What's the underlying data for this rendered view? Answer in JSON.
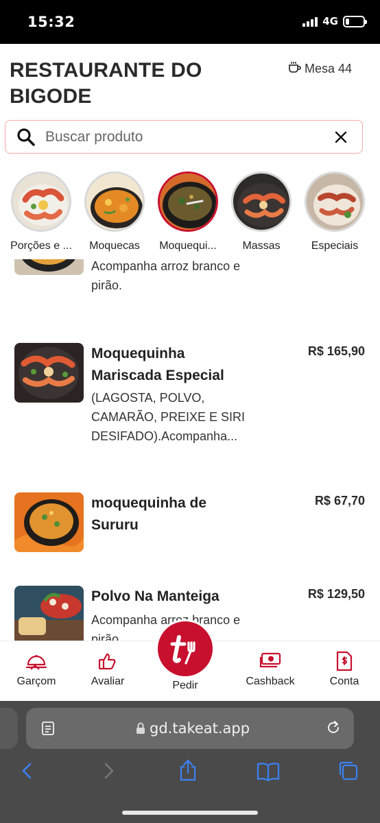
{
  "status_bar": {
    "time": "15:32",
    "network": "4G",
    "battery_level": 0.22
  },
  "header": {
    "restaurant_name": "RESTAURANTE DO BIGODE",
    "table_label": "Mesa 44"
  },
  "search": {
    "placeholder": "Buscar produto",
    "value": ""
  },
  "categories": [
    {
      "label": "Porções e ...",
      "active": false
    },
    {
      "label": "Moquecas",
      "active": false
    },
    {
      "label": "Moquequi...",
      "active": true
    },
    {
      "label": "Massas",
      "active": false
    },
    {
      "label": "Especiais",
      "active": false
    }
  ],
  "products": [
    {
      "name": "",
      "description": "Acompanha arroz branco e pirão.",
      "price": ""
    },
    {
      "name": "Moquequinha Mariscada Especial",
      "description": "(LAGOSTA, POLVO, CAMARÃO, PREIXE E SIRI DESIFADO).Acompanha...",
      "price": "R$ 165,90"
    },
    {
      "name": "moquequinha de Sururu",
      "description": "",
      "price": "R$ 67,70"
    },
    {
      "name": "Polvo Na Manteiga",
      "description": "Acompanha arroz branco e pirão.",
      "price": "R$ 129,50"
    }
  ],
  "bottom_nav": {
    "garcom": "Garçom",
    "avaliar": "Avaliar",
    "pedir": "Pedir",
    "cashback": "Cashback",
    "conta": "Conta"
  },
  "browser": {
    "url": "gd.takeat.app"
  },
  "colors": {
    "accent": "#c8102e",
    "search_border": "#f4a9a9",
    "browser_bg": "#4a4a4a",
    "link_blue": "#3b82f6"
  },
  "icons": [
    "cup-icon",
    "search-icon",
    "close-icon",
    "waiter-icon",
    "thumbs-up-icon",
    "takeat-logo-icon",
    "cashback-icon",
    "bill-icon",
    "reader-icon",
    "lock-icon",
    "reload-icon",
    "back-icon",
    "forward-icon",
    "share-icon",
    "bookmarks-icon",
    "tabs-icon"
  ]
}
